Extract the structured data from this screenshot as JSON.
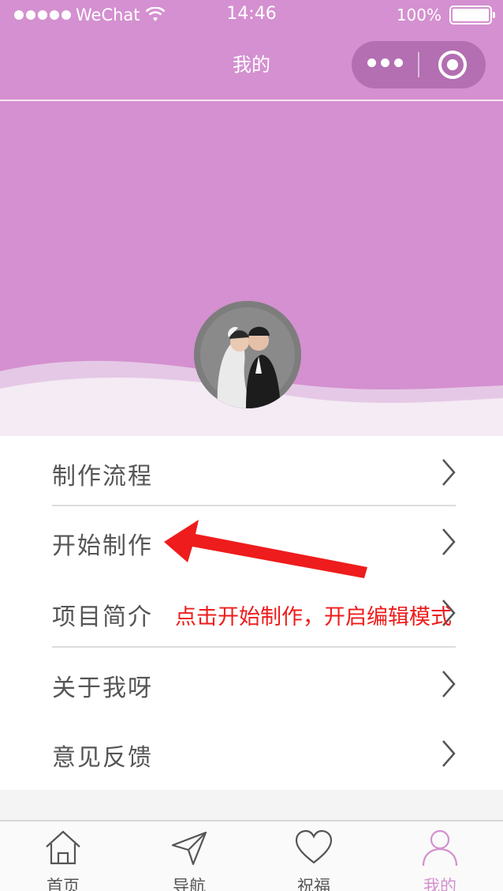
{
  "status_bar": {
    "carrier": "WeChat",
    "time": "14:46",
    "battery": "100%"
  },
  "nav": {
    "title": "我的"
  },
  "menu": {
    "items": [
      {
        "label": "制作流程"
      },
      {
        "label": "开始制作"
      },
      {
        "label": "项目简介"
      },
      {
        "label": "关于我呀"
      },
      {
        "label": "意见反馈"
      }
    ]
  },
  "annotation": {
    "text": "点击开始制作，开启编辑模式",
    "color": "#ee1c1c"
  },
  "tabbar": {
    "tabs": [
      {
        "label": "首页",
        "icon": "home-icon"
      },
      {
        "label": "导航",
        "icon": "navigation-icon"
      },
      {
        "label": "祝福",
        "icon": "heart-icon"
      },
      {
        "label": "我的",
        "icon": "user-icon",
        "active": true
      }
    ]
  },
  "colors": {
    "accent": "#d490d0",
    "page_background": "#f4f4f4"
  }
}
